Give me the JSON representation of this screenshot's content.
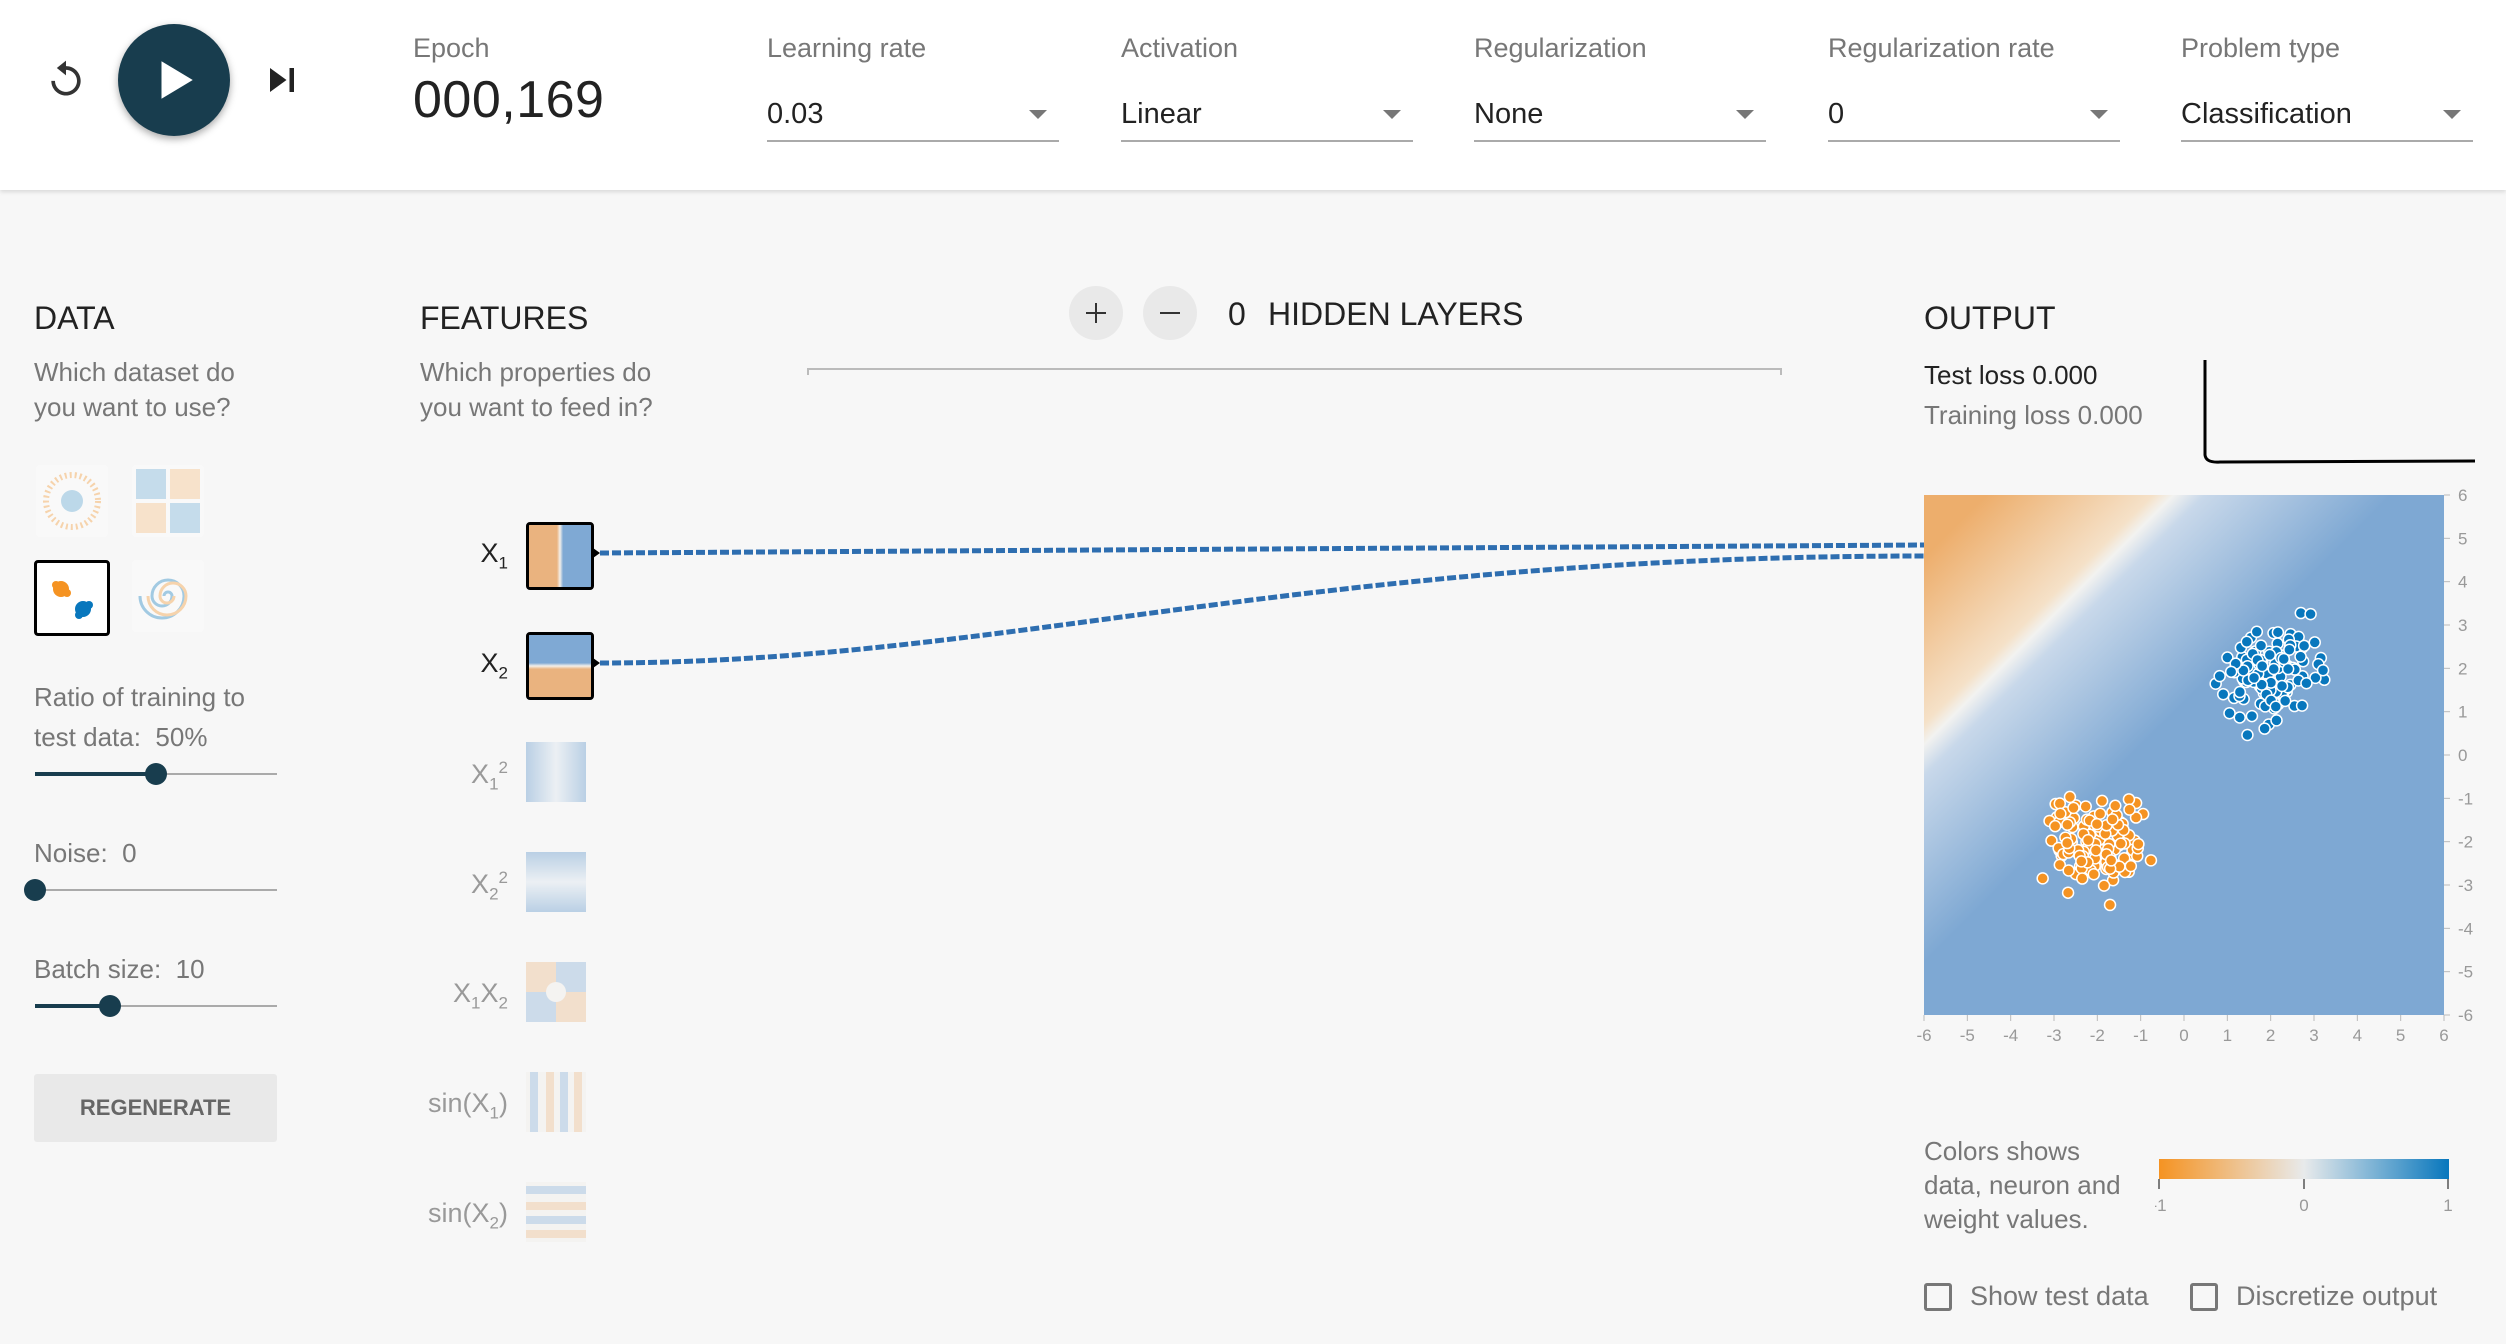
{
  "controls": {
    "reset_icon": "reset-icon",
    "play_icon": "play-icon",
    "step_icon": "step-forward-icon",
    "epoch_label": "Epoch",
    "epoch_value": "000,169",
    "learning_rate": {
      "label": "Learning rate",
      "value": "0.03"
    },
    "activation": {
      "label": "Activation",
      "value": "Linear"
    },
    "regularization": {
      "label": "Regularization",
      "value": "None"
    },
    "regularization_rate": {
      "label": "Regularization rate",
      "value": "0"
    },
    "problem_type": {
      "label": "Problem type",
      "value": "Classification"
    }
  },
  "data_panel": {
    "title": "DATA",
    "subtitle_1": "Which dataset do",
    "subtitle_2": "you want to use?",
    "datasets": [
      "circle",
      "xor",
      "gaussian",
      "spiral"
    ],
    "selected_dataset": "gaussian",
    "ratio_label_1": "Ratio of training to",
    "ratio_label_2": "test data:",
    "ratio_value": "50%",
    "ratio_fraction": 0.5,
    "noise_label": "Noise:",
    "noise_value": "0",
    "noise_fraction": 0,
    "batch_label": "Batch size:",
    "batch_value": "10",
    "batch_fraction": 0.31,
    "regenerate_label": "REGENERATE"
  },
  "features_panel": {
    "title": "FEATURES",
    "subtitle_1": "Which properties do",
    "subtitle_2": "you want to feed in?",
    "features": [
      {
        "base": "X",
        "sub": "1",
        "sup": "",
        "tail": "",
        "active": true
      },
      {
        "base": "X",
        "sub": "2",
        "sup": "",
        "tail": "",
        "active": true
      },
      {
        "base": "X",
        "sub": "1",
        "sup": "2",
        "tail": "",
        "active": false
      },
      {
        "base": "X",
        "sub": "2",
        "sup": "2",
        "tail": "",
        "active": false
      },
      {
        "base": "X",
        "sub": "1",
        "sup": "",
        "tail": "X2",
        "active": false
      },
      {
        "base": "sin(X",
        "sub": "1",
        "sup": "",
        "tail": ")",
        "active": false
      },
      {
        "base": "sin(X",
        "sub": "2",
        "sup": "",
        "tail": ")",
        "active": false
      }
    ]
  },
  "network": {
    "add_layer_icon": "plus-icon",
    "remove_layer_icon": "minus-icon",
    "layer_count": "0",
    "hidden_layers_label": "HIDDEN LAYERS"
  },
  "output_panel": {
    "title": "OUTPUT",
    "test_loss_label": "Test loss",
    "test_loss_value": "0.000",
    "training_loss_label": "Training loss",
    "training_loss_value": "0.000",
    "axis_ticks": [
      "-6",
      "-5",
      "-4",
      "-3",
      "-2",
      "-1",
      "0",
      "1",
      "2",
      "3",
      "4",
      "5",
      "6"
    ],
    "legend_text": "Colors shows data, neuron and weight values.",
    "legend_ticks": [
      "-1",
      "0",
      "1"
    ],
    "show_test_data_label": "Show test data",
    "discretize_label": "Discretize output",
    "colors": {
      "orange": "#f59322",
      "blue": "#0877bd",
      "dark": "#183d4e"
    }
  }
}
